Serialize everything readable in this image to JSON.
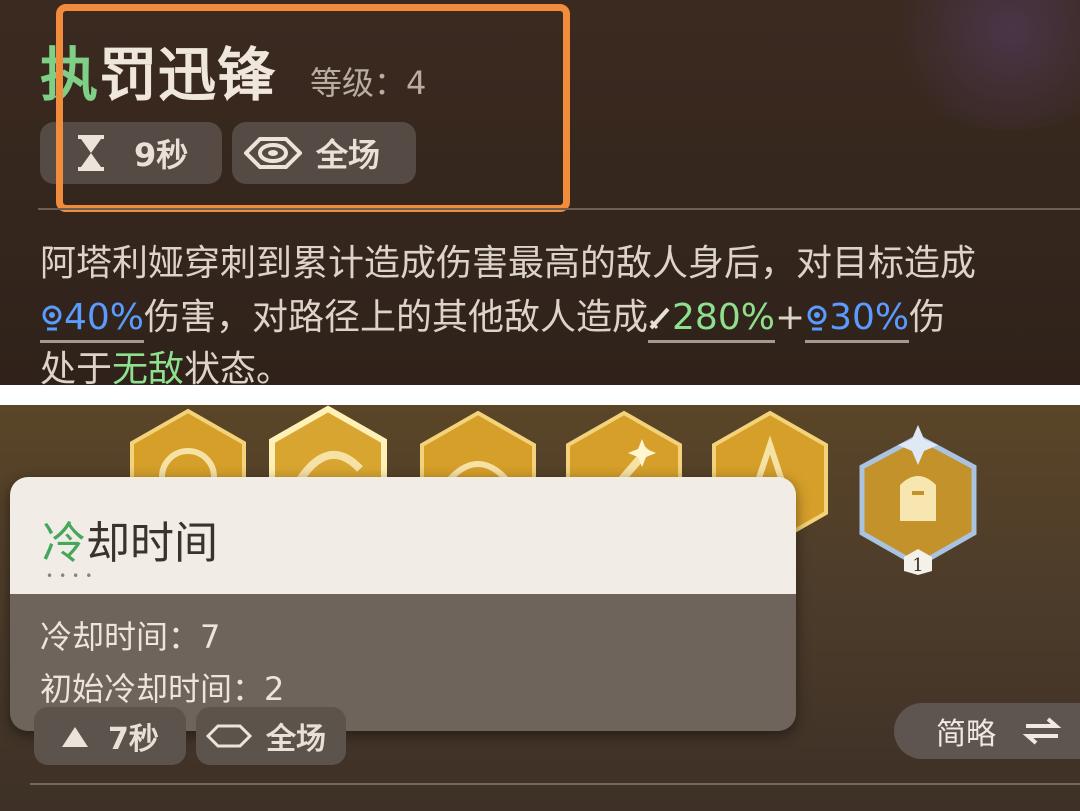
{
  "skill": {
    "name_first_char": "执",
    "name_rest": "罚迅锋",
    "level_label": "等级：4",
    "chips": {
      "time": "9秒",
      "area": "全场"
    },
    "description": {
      "line1": "阿塔利娅穿刺到累计造成伤害最高的敌人身后，对目标造成",
      "line2_pct1": "40%",
      "line2_text1": "伤害，对路径上的其他敌人造成",
      "line2_pct2": "280%",
      "line2_plus": "+",
      "line2_pct3": "30%",
      "line2_tail": "伤",
      "line3_text1": "处于",
      "line3_green": "无敌",
      "line3_text2": "状态。"
    }
  },
  "tooltip": {
    "title_first": "冷",
    "title_rest": "却时间",
    "dots": "••••",
    "cooldown": "冷却时间：7",
    "initial_cooldown": "初始冷却时间：2"
  },
  "bottom_chips": {
    "time": "7秒",
    "area": "全场"
  },
  "toggle": {
    "label": "简略"
  },
  "hex_badge": "1",
  "icons": [
    "hourglass-icon",
    "eye-area-icon",
    "magic-damage-icon",
    "sword-damage-icon",
    "swap-icon"
  ],
  "colors": {
    "highlight": "#f08c3c",
    "green": "#8ee08e",
    "blue": "#5a9bff",
    "gold": "#d9a22a"
  }
}
